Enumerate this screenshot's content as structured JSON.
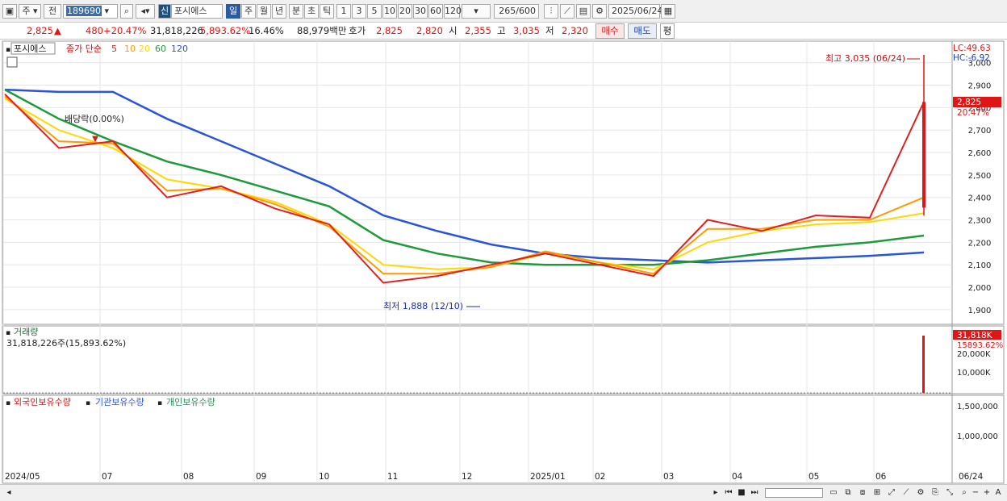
{
  "toolbar": {
    "period_type": "주",
    "prev_label": "전",
    "stock_code": "189690",
    "new_badge": "신",
    "stock_name": "포시에스",
    "interval_day": "일",
    "interval_week": "주",
    "interval_month": "월",
    "interval_year": "년",
    "interval_min": "분",
    "interval_tick_sec": "초",
    "interval_tick": "틱",
    "minute_options": [
      "1",
      "3",
      "5",
      "10",
      "20",
      "30",
      "60",
      "120"
    ],
    "bar_count": "265",
    "bar_max": "/600",
    "date": "2025/06/24"
  },
  "quote": {
    "price": "2,825",
    "change": "480",
    "change_pct": "+20.47%",
    "volume": "31,818,226",
    "volume_ratio": "5,893.62%",
    "turnover_rate": "16.46%",
    "trade_value": "88,979백만",
    "ask_label": "호가",
    "ask": "2,825",
    "bid": "2,820",
    "open_label": "시",
    "open": "2,355",
    "high_label": "고",
    "high": "3,035",
    "low_label": "저",
    "low": "2,320",
    "buy_button": "매수",
    "sell_button": "매도",
    "eval_button": "평"
  },
  "price_panel": {
    "stock_tab": "포시에스",
    "ma_title": "종가 단순",
    "ma_periods": [
      "5",
      "10",
      "20",
      "60",
      "120"
    ],
    "lc_label": "LC:49.63",
    "hc_label": "HC:-6.92",
    "current_price_tag": "2,825",
    "current_pct_tag": "20.47%",
    "high_note": "최고 3,035 (06/24)",
    "low_note": "최저 1,888 (12/10)",
    "dividend_note": "배당락(0.00%)",
    "y_ticks": [
      "3,000",
      "2,900",
      "2,800",
      "2,700",
      "2,600",
      "2,500",
      "2,400",
      "2,300",
      "2,200",
      "2,100",
      "2,000",
      "1,900"
    ]
  },
  "volume_panel": {
    "title": "거래량",
    "value": "31,818,226주(15,893.62%)",
    "tag": "31,818K",
    "tag_pct": "15893.62%",
    "y_ticks": [
      "20,000K",
      "10,000K"
    ]
  },
  "holdings_panel": {
    "legend_foreign": "외국인보유수량",
    "legend_inst": "기관보유수량",
    "legend_indiv": "개인보유수량",
    "y_ticks": [
      "1,500,000",
      "1,000,000"
    ]
  },
  "x_axis": [
    "2024/05",
    "07",
    "08",
    "09",
    "10",
    "11",
    "12",
    "2025/01",
    "02",
    "03",
    "04",
    "05",
    "06",
    "06/24"
  ],
  "colors": {
    "up": "#e01515",
    "down": "#1a3fc0",
    "ma5": "#e02020",
    "ma10": "#ff9900",
    "ma20": "#ffd800",
    "ma60": "#1f9a3a",
    "ma120": "#2a55d6",
    "foreign": "#e01515",
    "inst": "#2a55d6",
    "indiv": "#2e8b57"
  },
  "chart_data": {
    "type": "line",
    "x": [
      "2024/05",
      "07",
      "08",
      "09",
      "10",
      "11",
      "12",
      "2025/01",
      "02",
      "03",
      "04",
      "05",
      "06",
      "06/24"
    ],
    "ylim": [
      1860,
      3060
    ],
    "series": [
      {
        "name": "5",
        "values": [
          2860,
          2620,
          2650,
          2400,
          2450,
          2350,
          2280,
          2020,
          2050,
          2100,
          2150,
          2100,
          2050,
          2300,
          2250,
          2320,
          2310,
          2825
        ]
      },
      {
        "name": "10",
        "values": [
          2850,
          2650,
          2640,
          2430,
          2440,
          2370,
          2270,
          2060,
          2060,
          2090,
          2160,
          2110,
          2060,
          2260,
          2260,
          2300,
          2300,
          2400
        ]
      },
      {
        "name": "20",
        "values": [
          2840,
          2700,
          2620,
          2480,
          2440,
          2380,
          2280,
          2100,
          2080,
          2090,
          2150,
          2110,
          2080,
          2200,
          2250,
          2280,
          2290,
          2330
        ]
      },
      {
        "name": "60",
        "values": [
          2880,
          2750,
          2650,
          2560,
          2500,
          2430,
          2360,
          2210,
          2150,
          2110,
          2100,
          2100,
          2100,
          2120,
          2150,
          2180,
          2200,
          2230
        ]
      },
      {
        "name": "120",
        "values": [
          2880,
          2870,
          2870,
          2750,
          2650,
          2550,
          2450,
          2320,
          2250,
          2190,
          2150,
          2130,
          2120,
          2110,
          2120,
          2130,
          2140,
          2155
        ]
      }
    ]
  }
}
